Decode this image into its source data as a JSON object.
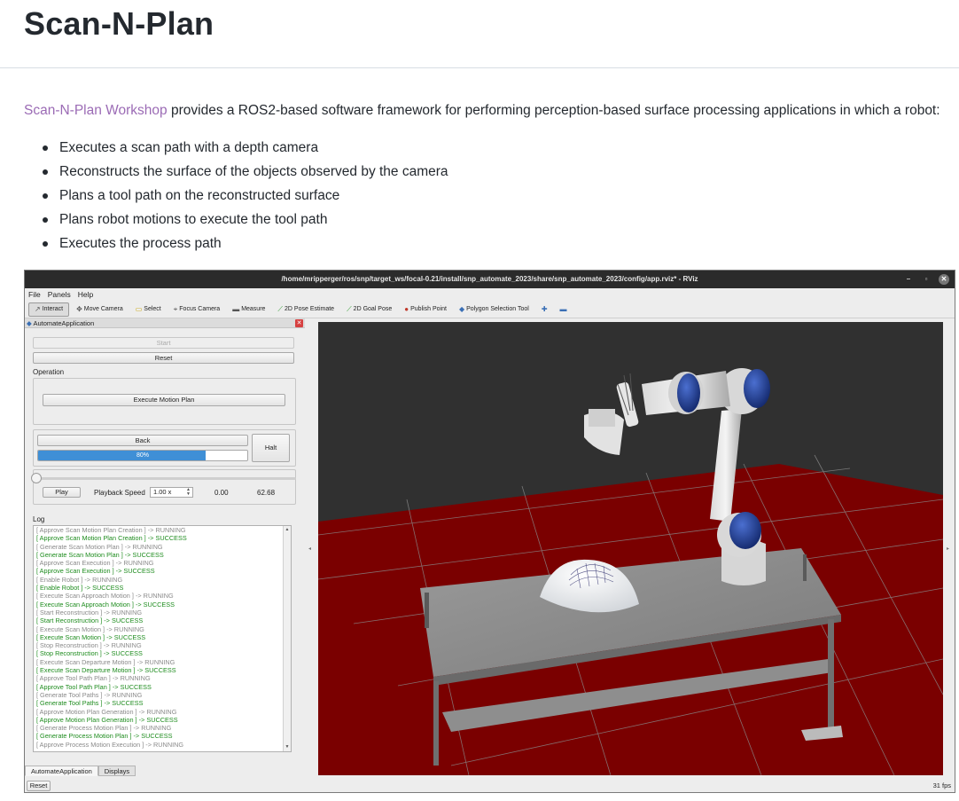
{
  "page": {
    "title": "Scan-N-Plan",
    "intro_link": "Scan-N-Plan Workshop",
    "intro_text": " provides a ROS2-based software framework for performing perception-based surface processing applications in which a robot:",
    "bullets": [
      "Executes a scan path with a depth camera",
      "Reconstructs the surface of the objects observed by the camera",
      "Plans a tool path on the reconstructed surface",
      "Plans robot motions to execute the tool path",
      "Executes the process path"
    ],
    "link_color": "#9b6bb5"
  },
  "rviz": {
    "window_title": "/home/mripperger/ros/snp/target_ws/focal-0.21/install/snp_automate_2023/share/snp_automate_2023/config/app.rviz* - RViz",
    "menu": [
      "File",
      "Panels",
      "Help"
    ],
    "toolbar": [
      {
        "label": "Interact",
        "icon": "interact-icon"
      },
      {
        "label": "Move Camera",
        "icon": "move-camera-icon"
      },
      {
        "label": "Select",
        "icon": "select-icon"
      },
      {
        "label": "Focus Camera",
        "icon": "focus-camera-icon"
      },
      {
        "label": "Measure",
        "icon": "measure-icon"
      },
      {
        "label": "2D Pose Estimate",
        "icon": "pose-estimate-icon"
      },
      {
        "label": "2D Goal Pose",
        "icon": "goal-pose-icon"
      },
      {
        "label": "Publish Point",
        "icon": "publish-point-icon"
      },
      {
        "label": "Polygon Selection Tool",
        "icon": "polygon-selection-icon"
      }
    ],
    "panel": {
      "title": "AutomateApplication",
      "start_label": "Start",
      "reset_label": "Reset",
      "operation_label": "Operation",
      "execute_label": "Execute Motion Plan",
      "back_label": "Back",
      "halt_label": "Halt",
      "progress": 80,
      "progress_text": "80%",
      "play_label": "Play",
      "playback_speed_label": "Playback Speed",
      "playback_speed_value": "1.00 x",
      "time_current": "0.00",
      "time_total": "62.68",
      "log_label": "Log"
    },
    "log": [
      {
        "text": "[ Approve Scan Motion Plan Creation ]  -> RUNNING",
        "status": "running"
      },
      {
        "text": "[ Approve Scan Motion Plan Creation ]  -> SUCCESS",
        "status": "success"
      },
      {
        "text": "[ Generate Scan Motion Plan ]  -> RUNNING",
        "status": "running"
      },
      {
        "text": "[ Generate Scan Motion Plan ]  -> SUCCESS",
        "status": "success"
      },
      {
        "text": "[ Approve Scan Execution ]  -> RUNNING",
        "status": "running"
      },
      {
        "text": "[ Approve Scan Execution ]  -> SUCCESS",
        "status": "success"
      },
      {
        "text": "[ Enable Robot ]  -> RUNNING",
        "status": "running"
      },
      {
        "text": "[ Enable Robot ]  -> SUCCESS",
        "status": "success"
      },
      {
        "text": "[ Execute Scan Approach Motion ]  -> RUNNING",
        "status": "running"
      },
      {
        "text": "[ Execute Scan Approach Motion ]  -> SUCCESS",
        "status": "success"
      },
      {
        "text": "[ Start Reconstruction ]  -> RUNNING",
        "status": "running"
      },
      {
        "text": "[ Start Reconstruction ]  -> SUCCESS",
        "status": "success"
      },
      {
        "text": "[ Execute Scan Motion ]  -> RUNNING",
        "status": "running"
      },
      {
        "text": "[ Execute Scan Motion ]  -> SUCCESS",
        "status": "success"
      },
      {
        "text": "[ Stop Reconstruction ]  -> RUNNING",
        "status": "running"
      },
      {
        "text": "[ Stop Reconstruction ]  -> SUCCESS",
        "status": "success"
      },
      {
        "text": "[ Execute Scan Departure Motion ]  -> RUNNING",
        "status": "running"
      },
      {
        "text": "[ Execute Scan Departure Motion ]  -> SUCCESS",
        "status": "success"
      },
      {
        "text": "[ Approve Tool Path Plan ]  -> RUNNING",
        "status": "running"
      },
      {
        "text": "[ Approve Tool Path Plan ]  -> SUCCESS",
        "status": "success"
      },
      {
        "text": "[ Generate Tool Paths ]  -> RUNNING",
        "status": "running"
      },
      {
        "text": "[ Generate Tool Paths ]  -> SUCCESS",
        "status": "success"
      },
      {
        "text": "[ Approve Motion Plan Generation ]  -> RUNNING",
        "status": "running"
      },
      {
        "text": "[ Approve Motion Plan Generation ]  -> SUCCESS",
        "status": "success"
      },
      {
        "text": "[ Generate Process Motion Plan ]  -> RUNNING",
        "status": "running"
      },
      {
        "text": "[ Generate Process Motion Plan ]  -> SUCCESS",
        "status": "success"
      },
      {
        "text": "[ Approve Process Motion Execution ]  -> RUNNING",
        "status": "running"
      }
    ],
    "tabs": [
      "AutomateApplication",
      "Displays"
    ],
    "status_reset_label": "Reset",
    "fps": "31 fps",
    "colors": {
      "background": "#303030",
      "floor": "#7a0000",
      "joint_blue": "#1f3f9a",
      "progress": "#3f8fd6",
      "log_running": "#8a8a8a",
      "log_success": "#1e8c1e"
    }
  }
}
